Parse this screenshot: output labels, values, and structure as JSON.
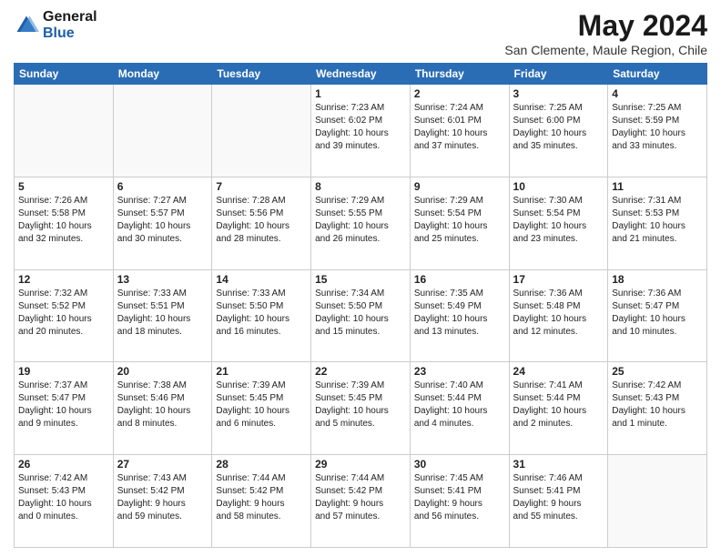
{
  "header": {
    "logo_general": "General",
    "logo_blue": "Blue",
    "month_title": "May 2024",
    "location": "San Clemente, Maule Region, Chile"
  },
  "days_of_week": [
    "Sunday",
    "Monday",
    "Tuesday",
    "Wednesday",
    "Thursday",
    "Friday",
    "Saturday"
  ],
  "weeks": [
    [
      {
        "day": "",
        "info": ""
      },
      {
        "day": "",
        "info": ""
      },
      {
        "day": "",
        "info": ""
      },
      {
        "day": "1",
        "info": "Sunrise: 7:23 AM\nSunset: 6:02 PM\nDaylight: 10 hours\nand 39 minutes."
      },
      {
        "day": "2",
        "info": "Sunrise: 7:24 AM\nSunset: 6:01 PM\nDaylight: 10 hours\nand 37 minutes."
      },
      {
        "day": "3",
        "info": "Sunrise: 7:25 AM\nSunset: 6:00 PM\nDaylight: 10 hours\nand 35 minutes."
      },
      {
        "day": "4",
        "info": "Sunrise: 7:25 AM\nSunset: 5:59 PM\nDaylight: 10 hours\nand 33 minutes."
      }
    ],
    [
      {
        "day": "5",
        "info": "Sunrise: 7:26 AM\nSunset: 5:58 PM\nDaylight: 10 hours\nand 32 minutes."
      },
      {
        "day": "6",
        "info": "Sunrise: 7:27 AM\nSunset: 5:57 PM\nDaylight: 10 hours\nand 30 minutes."
      },
      {
        "day": "7",
        "info": "Sunrise: 7:28 AM\nSunset: 5:56 PM\nDaylight: 10 hours\nand 28 minutes."
      },
      {
        "day": "8",
        "info": "Sunrise: 7:29 AM\nSunset: 5:55 PM\nDaylight: 10 hours\nand 26 minutes."
      },
      {
        "day": "9",
        "info": "Sunrise: 7:29 AM\nSunset: 5:54 PM\nDaylight: 10 hours\nand 25 minutes."
      },
      {
        "day": "10",
        "info": "Sunrise: 7:30 AM\nSunset: 5:54 PM\nDaylight: 10 hours\nand 23 minutes."
      },
      {
        "day": "11",
        "info": "Sunrise: 7:31 AM\nSunset: 5:53 PM\nDaylight: 10 hours\nand 21 minutes."
      }
    ],
    [
      {
        "day": "12",
        "info": "Sunrise: 7:32 AM\nSunset: 5:52 PM\nDaylight: 10 hours\nand 20 minutes."
      },
      {
        "day": "13",
        "info": "Sunrise: 7:33 AM\nSunset: 5:51 PM\nDaylight: 10 hours\nand 18 minutes."
      },
      {
        "day": "14",
        "info": "Sunrise: 7:33 AM\nSunset: 5:50 PM\nDaylight: 10 hours\nand 16 minutes."
      },
      {
        "day": "15",
        "info": "Sunrise: 7:34 AM\nSunset: 5:50 PM\nDaylight: 10 hours\nand 15 minutes."
      },
      {
        "day": "16",
        "info": "Sunrise: 7:35 AM\nSunset: 5:49 PM\nDaylight: 10 hours\nand 13 minutes."
      },
      {
        "day": "17",
        "info": "Sunrise: 7:36 AM\nSunset: 5:48 PM\nDaylight: 10 hours\nand 12 minutes."
      },
      {
        "day": "18",
        "info": "Sunrise: 7:36 AM\nSunset: 5:47 PM\nDaylight: 10 hours\nand 10 minutes."
      }
    ],
    [
      {
        "day": "19",
        "info": "Sunrise: 7:37 AM\nSunset: 5:47 PM\nDaylight: 10 hours\nand 9 minutes."
      },
      {
        "day": "20",
        "info": "Sunrise: 7:38 AM\nSunset: 5:46 PM\nDaylight: 10 hours\nand 8 minutes."
      },
      {
        "day": "21",
        "info": "Sunrise: 7:39 AM\nSunset: 5:45 PM\nDaylight: 10 hours\nand 6 minutes."
      },
      {
        "day": "22",
        "info": "Sunrise: 7:39 AM\nSunset: 5:45 PM\nDaylight: 10 hours\nand 5 minutes."
      },
      {
        "day": "23",
        "info": "Sunrise: 7:40 AM\nSunset: 5:44 PM\nDaylight: 10 hours\nand 4 minutes."
      },
      {
        "day": "24",
        "info": "Sunrise: 7:41 AM\nSunset: 5:44 PM\nDaylight: 10 hours\nand 2 minutes."
      },
      {
        "day": "25",
        "info": "Sunrise: 7:42 AM\nSunset: 5:43 PM\nDaylight: 10 hours\nand 1 minute."
      }
    ],
    [
      {
        "day": "26",
        "info": "Sunrise: 7:42 AM\nSunset: 5:43 PM\nDaylight: 10 hours\nand 0 minutes."
      },
      {
        "day": "27",
        "info": "Sunrise: 7:43 AM\nSunset: 5:42 PM\nDaylight: 9 hours\nand 59 minutes."
      },
      {
        "day": "28",
        "info": "Sunrise: 7:44 AM\nSunset: 5:42 PM\nDaylight: 9 hours\nand 58 minutes."
      },
      {
        "day": "29",
        "info": "Sunrise: 7:44 AM\nSunset: 5:42 PM\nDaylight: 9 hours\nand 57 minutes."
      },
      {
        "day": "30",
        "info": "Sunrise: 7:45 AM\nSunset: 5:41 PM\nDaylight: 9 hours\nand 56 minutes."
      },
      {
        "day": "31",
        "info": "Sunrise: 7:46 AM\nSunset: 5:41 PM\nDaylight: 9 hours\nand 55 minutes."
      },
      {
        "day": "",
        "info": ""
      }
    ]
  ]
}
